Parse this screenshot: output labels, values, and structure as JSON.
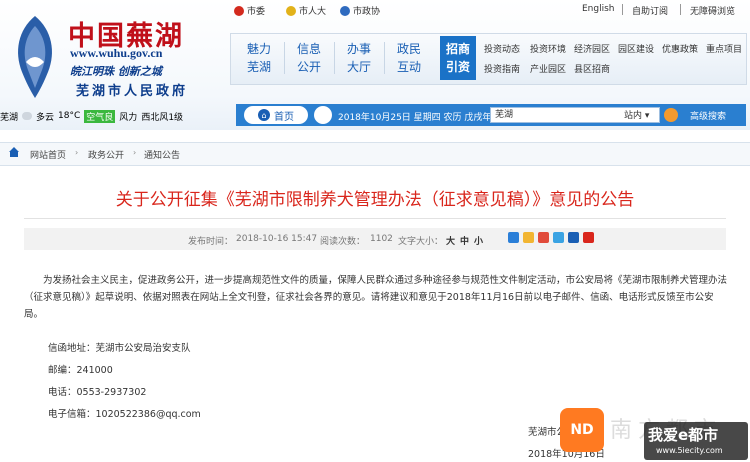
{
  "header": {
    "logo_title": "中国蕪湖",
    "logo_url": "www.wuhu.gov.cn",
    "logo_slogan": "皖江明珠 创新之城",
    "logo_gov": "芜湖市人民政府",
    "top_links": [
      "市委",
      "市人大",
      "市政协"
    ],
    "utility_links": [
      "English",
      "自助订阅",
      "无障碍浏览"
    ],
    "nav": [
      {
        "line1": "魅力",
        "line2": "芜湖"
      },
      {
        "line1": "信息",
        "line2": "公开"
      },
      {
        "line1": "办事",
        "line2": "大厅"
      },
      {
        "line1": "政民",
        "line2": "互动"
      }
    ],
    "nav_active": {
      "line1": "招商",
      "line2": "引资"
    },
    "sub_row1": [
      "投资动态",
      "投资环境",
      "经济园区",
      "园区建设",
      "优惠政策",
      "重点项目"
    ],
    "sub_row2": [
      "投资指南",
      "产业园区",
      "县区招商"
    ],
    "weather": {
      "city": "芜湖",
      "cond": "多云",
      "temp": "18°C",
      "air": "空气良",
      "wind_label": "风力",
      "wind": "西北风1级"
    },
    "home_label": "首页",
    "date_info": "2018年10月25日 星期四 农历 戊戌年",
    "search_value": "芜湖",
    "search_scope": "站内 ▾",
    "search_button": "高级搜索"
  },
  "breadcrumb": [
    "网站首页",
    "政务公开",
    "通知公告"
  ],
  "article": {
    "title": "关于公开征集《芜湖市限制养犬管理办法（征求意见稿）》意见的公告",
    "publish_label": "发布时间：",
    "publish_time": "2018-10-16 15:47",
    "views_label": "阅读次数：",
    "views": "1102",
    "font_label": "文字大小：",
    "font_sizes": [
      "大",
      "中",
      "小"
    ],
    "body": "为发扬社会主义民主，促进政务公开，进一步提高规范性文件的质量，保障人民群众通过多种途径参与规范性文件制定活动，市公安局将《芜湖市限制养犬管理办法（征求意见稿）》起草说明、依据对照表在网站上全文刊登，征求社会各界的意见。请将建议和意见于2018年11月16日前以电子邮件、信函、电话形式反馈至市公安局。",
    "address": "信函地址：芜湖市公安局治安支队",
    "postcode": "邮编：241000",
    "phone": "电话：0553-2937302",
    "email": "电子信箱：1020522386@qq.com",
    "signature": "芜湖市公",
    "sign_date": "2018年10月16日"
  },
  "watermark": {
    "logo": "ND",
    "faded": "南方都市",
    "badge": "我爱e都市",
    "badge_url": "www.5iecity.com"
  },
  "colors": {
    "title": "#d9261c",
    "nav_blue": "#1a72c7",
    "bar_blue": "#2a7fd0"
  }
}
